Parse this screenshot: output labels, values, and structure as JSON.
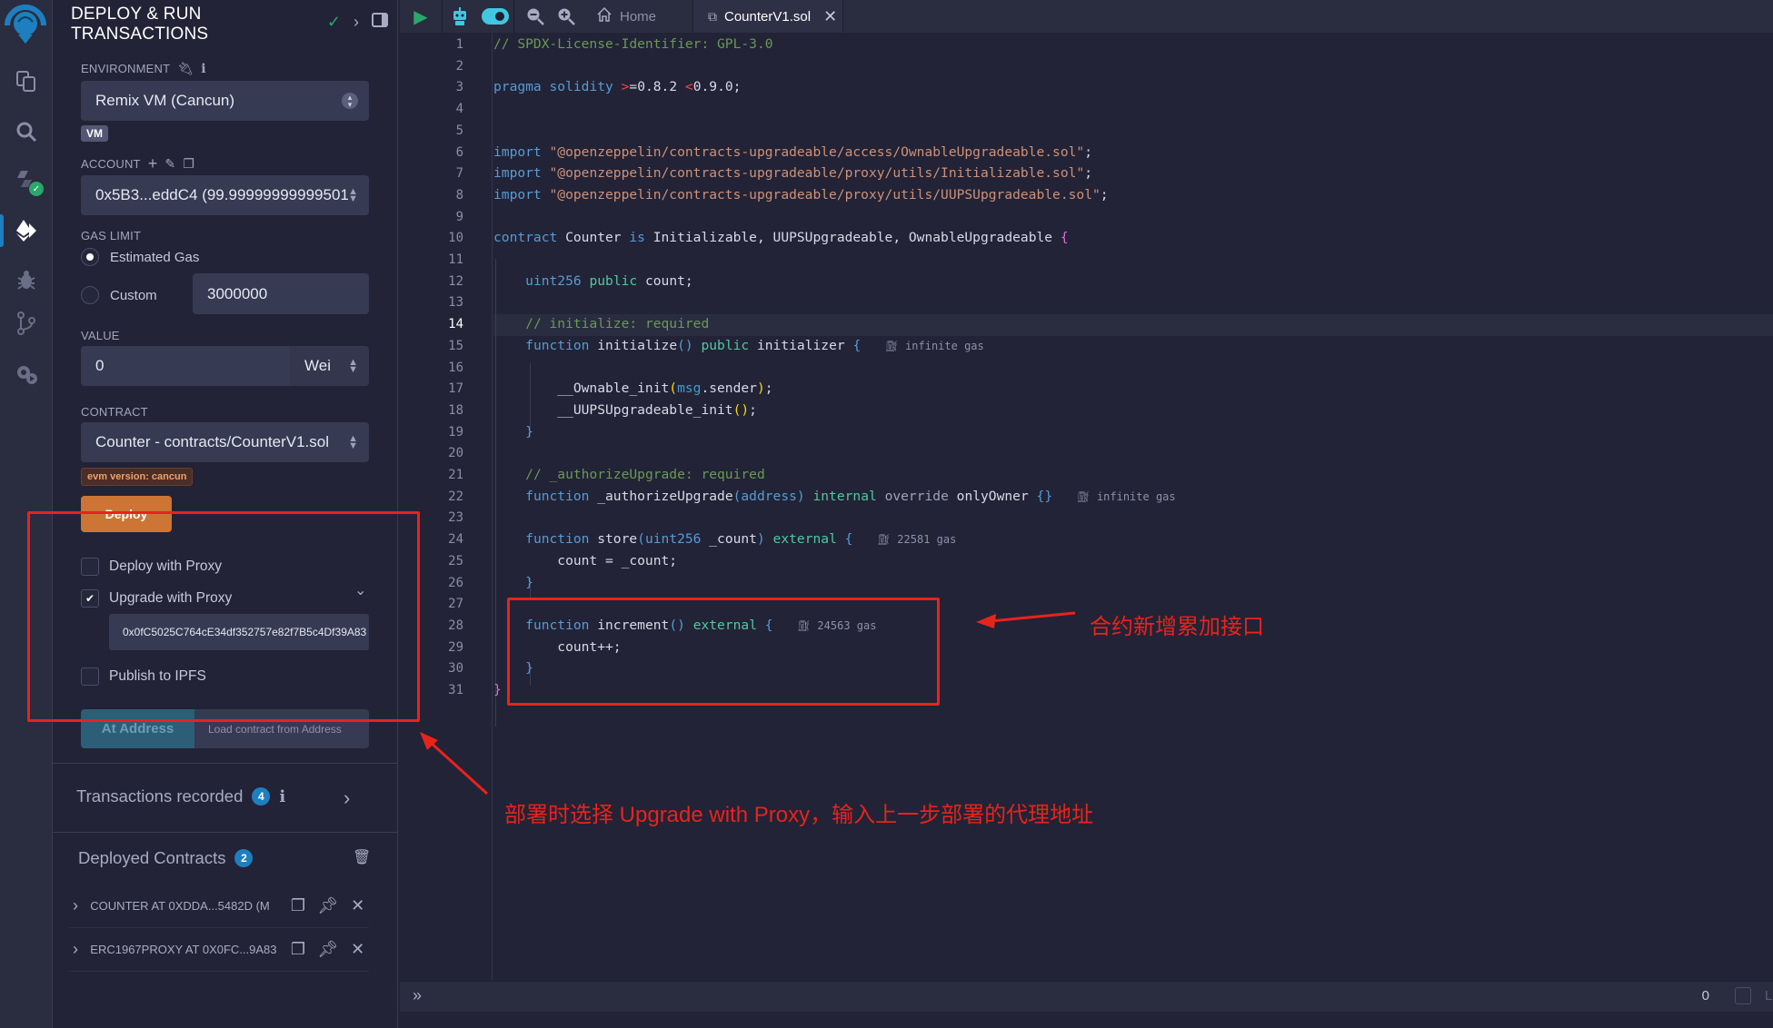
{
  "iconbar": {
    "items": [
      {
        "name": "logo",
        "icon": "remix-logo-icon"
      },
      {
        "name": "file-explorer",
        "icon": "files-icon"
      },
      {
        "name": "search",
        "icon": "search-icon"
      },
      {
        "name": "solidity-compiler",
        "icon": "compiler-icon",
        "status": "ok"
      },
      {
        "name": "deploy-run",
        "icon": "ethereum-deploy-icon",
        "active": true
      },
      {
        "name": "debugger",
        "icon": "bug-icon"
      },
      {
        "name": "git",
        "icon": "git-branch-icon"
      },
      {
        "name": "settings",
        "icon": "settings-icon"
      }
    ]
  },
  "panel": {
    "title_line1": "DEPLOY & RUN",
    "title_line2": "TRANSACTIONS",
    "environment": {
      "label": "ENVIRONMENT",
      "value": "Remix VM (Cancun)",
      "badge": "VM"
    },
    "account": {
      "label": "ACCOUNT",
      "value": "0x5B3...eddC4 (99.99999999999501"
    },
    "gas_limit": {
      "label": "GAS LIMIT",
      "options": [
        "Estimated Gas",
        "Custom"
      ],
      "selected": "Estimated Gas",
      "custom_value": "3000000"
    },
    "value": {
      "label": "VALUE",
      "amount": "0",
      "unit": "Wei"
    },
    "contract": {
      "label": "CONTRACT",
      "value": "Counter - contracts/CounterV1.sol",
      "evm_badge": "evm version: cancun"
    },
    "deploy_label": "Deploy",
    "deploy_with_proxy": {
      "label": "Deploy with Proxy",
      "checked": false
    },
    "upgrade_with_proxy": {
      "label": "Upgrade with Proxy",
      "checked": true
    },
    "proxy_address": "0x0fC5025C764cE34df352757e82f7B5c4Df39A83",
    "publish_ipfs": {
      "label": "Publish to IPFS",
      "checked": false
    },
    "at_address_label": "At Address",
    "at_address_placeholder": "Load contract from Address",
    "transactions": {
      "label": "Transactions recorded",
      "count": "4"
    },
    "deployed": {
      "label": "Deployed Contracts",
      "count": "2",
      "items": [
        {
          "name": "COUNTER AT 0XDDA...5482D (M"
        },
        {
          "name": "ERC1967PROXY AT 0X0FC...9A83"
        }
      ]
    }
  },
  "tabbar": {
    "home_label": "Home",
    "file_label": "CounterV1.sol"
  },
  "editor": {
    "current_line": 14,
    "line_count": 31,
    "gas_estimates": {
      "initialize": "infinite gas",
      "authorizeUpgrade": "infinite gas",
      "store": "22581 gas",
      "increment": "24563 gas"
    }
  },
  "statusbar": {
    "count": "0",
    "listen_label": "Lis"
  },
  "annotations": {
    "increment_note": "合约新增累加接口",
    "proxy_note": "部署时选择 Upgrade with Proxy，输入上一步部署的代理地址",
    "color": "#e8231c"
  },
  "colors": {
    "accent": "#1d7fbf",
    "deploy": "#cc7535",
    "background": "#222336"
  }
}
